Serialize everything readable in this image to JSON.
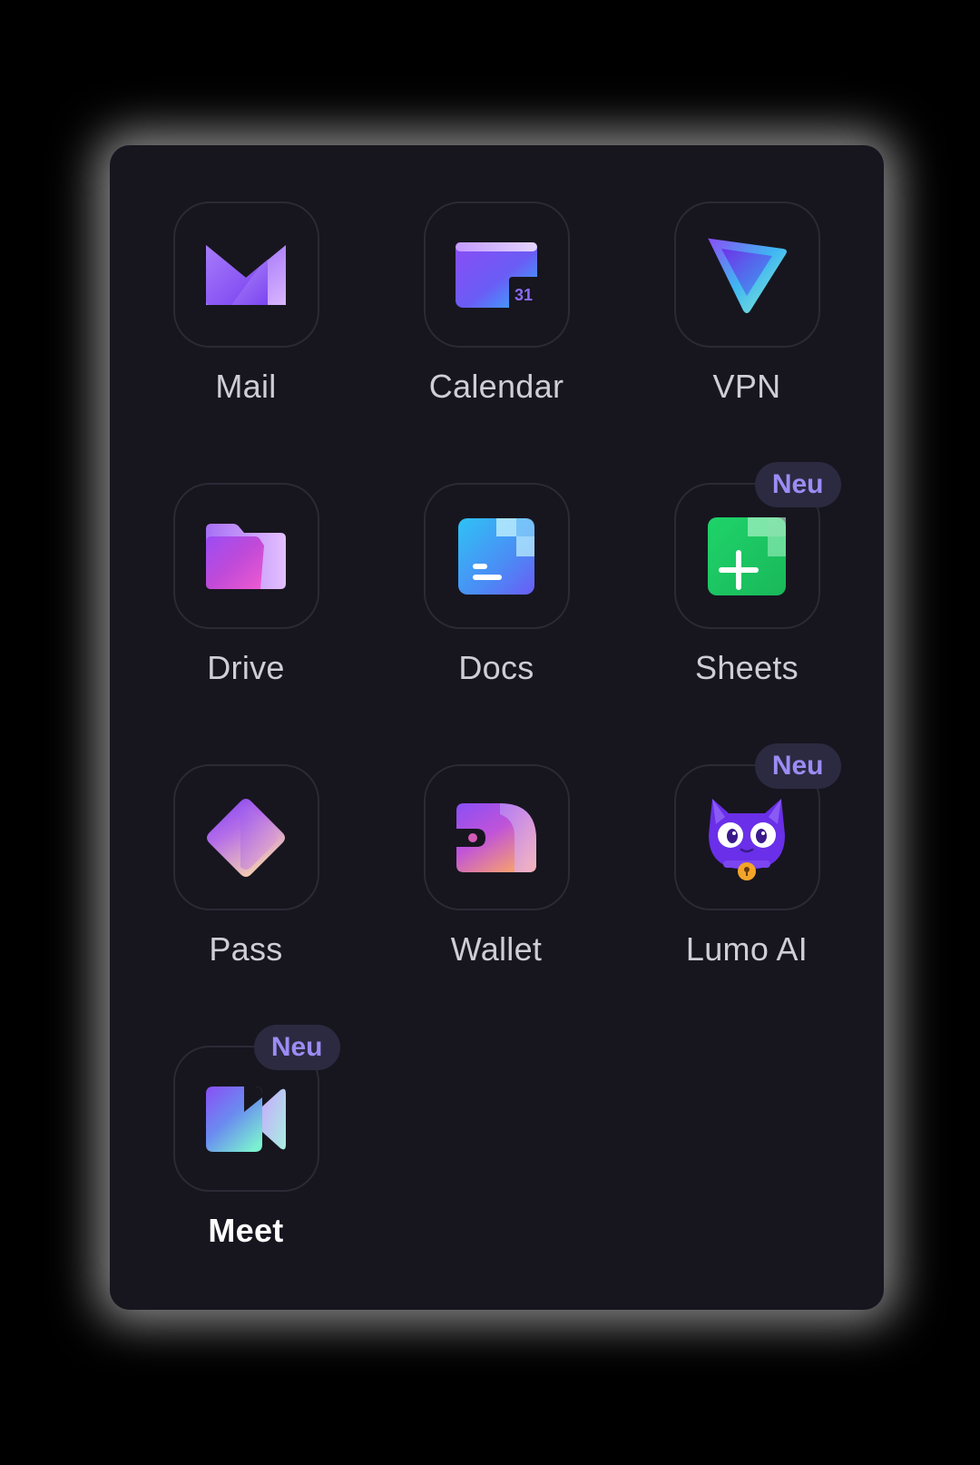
{
  "apps": [
    {
      "id": "mail",
      "label": "Mail",
      "icon": "mail-icon",
      "badge": "",
      "active": false
    },
    {
      "id": "calendar",
      "label": "Calendar",
      "icon": "calendar-icon",
      "badge": "",
      "active": false,
      "calendar_day": "31"
    },
    {
      "id": "vpn",
      "label": "VPN",
      "icon": "vpn-icon",
      "badge": "",
      "active": false
    },
    {
      "id": "drive",
      "label": "Drive",
      "icon": "folder-icon",
      "badge": "",
      "active": false
    },
    {
      "id": "docs",
      "label": "Docs",
      "icon": "document-icon",
      "badge": "",
      "active": false
    },
    {
      "id": "sheets",
      "label": "Sheets",
      "icon": "spreadsheet-icon",
      "badge": "Neu",
      "active": false
    },
    {
      "id": "pass",
      "label": "Pass",
      "icon": "diamond-key-icon",
      "badge": "",
      "active": false
    },
    {
      "id": "wallet",
      "label": "Wallet",
      "icon": "wallet-icon",
      "badge": "",
      "active": false
    },
    {
      "id": "lumo",
      "label": "Lumo AI",
      "icon": "cat-icon",
      "badge": "Neu",
      "active": false
    },
    {
      "id": "meet",
      "label": "Meet",
      "icon": "video-camera-icon",
      "badge": "Neu",
      "active": true
    }
  ],
  "colors": {
    "panel_background": "#17161f",
    "tile_border": "#2b2a35",
    "badge_background": "#2c2a40",
    "badge_text": "#9b8cf4",
    "label_text": "#cfced6",
    "active_label_text": "#ffffff"
  }
}
